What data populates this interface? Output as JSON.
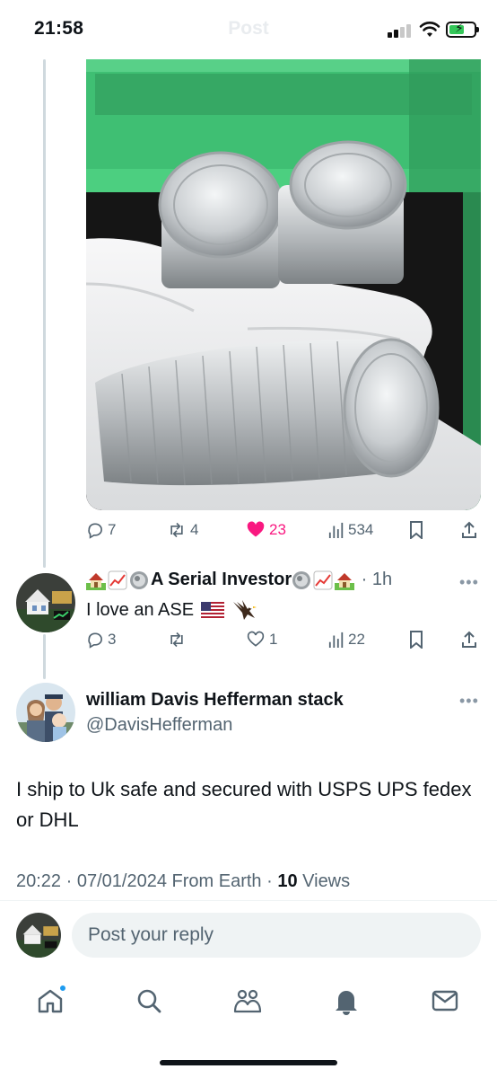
{
  "status_bar": {
    "time": "21:58",
    "title": "Post",
    "signal_bars": 2,
    "battery_charging": true
  },
  "original_post": {
    "media_alt": "stack of silver coins held in gloved hand",
    "stats": {
      "replies": "7",
      "reposts": "4",
      "likes": "23",
      "views": "534"
    },
    "liked": true
  },
  "reply": {
    "author_name": "A Serial Investor",
    "time": "1h",
    "text": "I love an ASE",
    "text_emojis": [
      "us-flag-emoji",
      "eagle-emoji"
    ],
    "stats": {
      "replies": "3",
      "reposts": "",
      "likes": "1",
      "views": "22"
    }
  },
  "main_post": {
    "author_name": "william Davis Hefferman stack",
    "handle": "@DavisHefferman",
    "text": "I ship to Uk safe and secured with USPS UPS fedex or DHL",
    "time": "20:22",
    "date": "07/01/2024",
    "location": "From Earth",
    "views_count": "10",
    "views_label": "Views"
  },
  "compose": {
    "placeholder": "Post your reply"
  },
  "tab_bar": {
    "items": [
      "home-icon",
      "search-icon",
      "communities-icon",
      "notifications-icon",
      "messages-icon"
    ],
    "home_has_badge": true
  },
  "colors": {
    "like": "#f91880",
    "muted": "#536471",
    "accent": "#1d9bf0",
    "text": "#0f1419"
  }
}
